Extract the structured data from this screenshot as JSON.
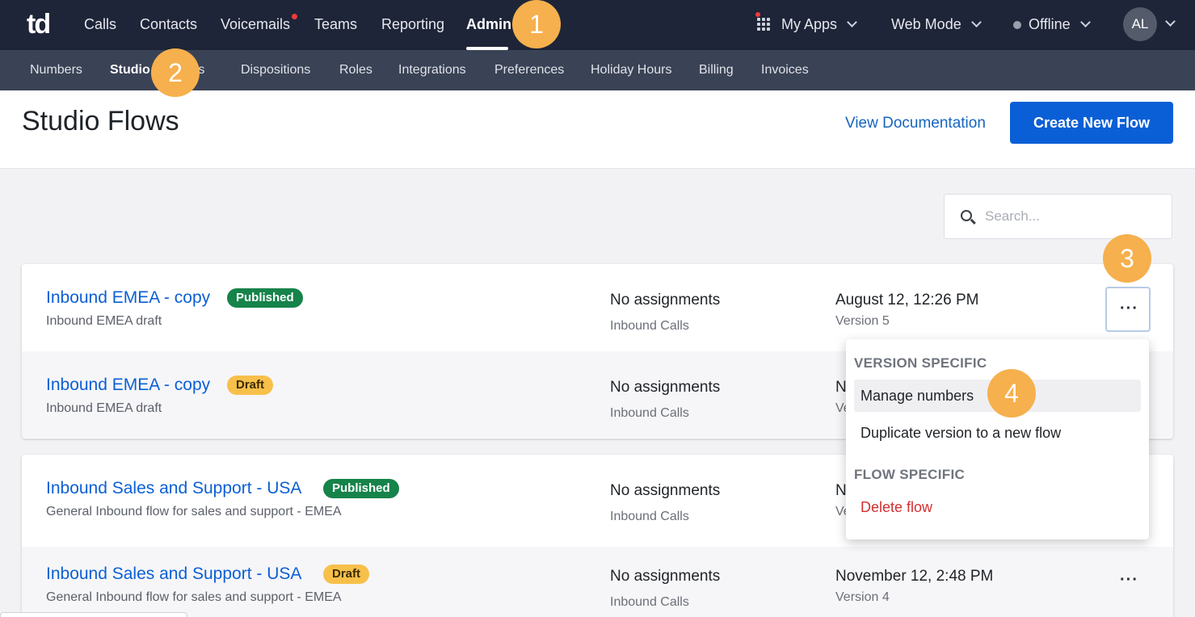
{
  "topnav": {
    "logo": "td",
    "items": [
      "Calls",
      "Contacts",
      "Voicemails",
      "Teams",
      "Reporting",
      "Admin"
    ],
    "active": "Admin",
    "my_apps": "My Apps",
    "mode": "Web Mode",
    "status": "Offline",
    "avatar_initials": "AL"
  },
  "subnav": {
    "items": [
      "Numbers",
      "Studio",
      "nts",
      "Dispositions",
      "Roles",
      "Integrations",
      "Preferences",
      "Holiday Hours",
      "Billing",
      "Invoices"
    ],
    "active": "Studio"
  },
  "header": {
    "title": "Studio Flows",
    "view_docs": "View Documentation",
    "create_button": "Create New Flow"
  },
  "search": {
    "placeholder": "Search..."
  },
  "flows": [
    {
      "rows": [
        {
          "name": "Inbound EMEA - copy",
          "badge": "Published",
          "desc": "Inbound EMEA draft",
          "assign": "No assignments",
          "assign_sub": "Inbound Calls",
          "date": "August 12, 12:26 PM",
          "version": "Version 5"
        },
        {
          "name": "Inbound EMEA - copy",
          "badge": "Draft",
          "desc": "Inbound EMEA draft",
          "assign": "No assignments",
          "assign_sub": "Inbound Calls",
          "date": "N",
          "version": "Ve"
        }
      ]
    },
    {
      "rows": [
        {
          "name": "Inbound Sales and Support - USA",
          "badge": "Published",
          "desc": "General Inbound flow for sales and support - EMEA",
          "assign": "No assignments",
          "assign_sub": "Inbound Calls",
          "date": "N",
          "version": "Ve"
        },
        {
          "name": "Inbound Sales and Support - USA",
          "badge": "Draft",
          "desc": "General Inbound flow for sales and support - EMEA",
          "assign": "No assignments",
          "assign_sub": "Inbound Calls",
          "date": "November 12, 2:48 PM",
          "version": "Version 4"
        }
      ]
    }
  ],
  "menu": {
    "version_heading": "VERSION SPECIFIC",
    "manage_numbers": "Manage numbers",
    "duplicate": "Duplicate version to a new flow",
    "flow_heading": "FLOW SPECIFIC",
    "delete": "Delete flow"
  },
  "more_glyph": "···",
  "markers": [
    "1",
    "2",
    "3",
    "4"
  ],
  "colors": {
    "nav_bg": "#1e2538",
    "subnav_bg": "#3a4255",
    "primary": "#0b5fd6",
    "published": "#16834a",
    "draft": "#f7c04a",
    "marker": "#f6b04d",
    "danger": "#d32f2f"
  }
}
